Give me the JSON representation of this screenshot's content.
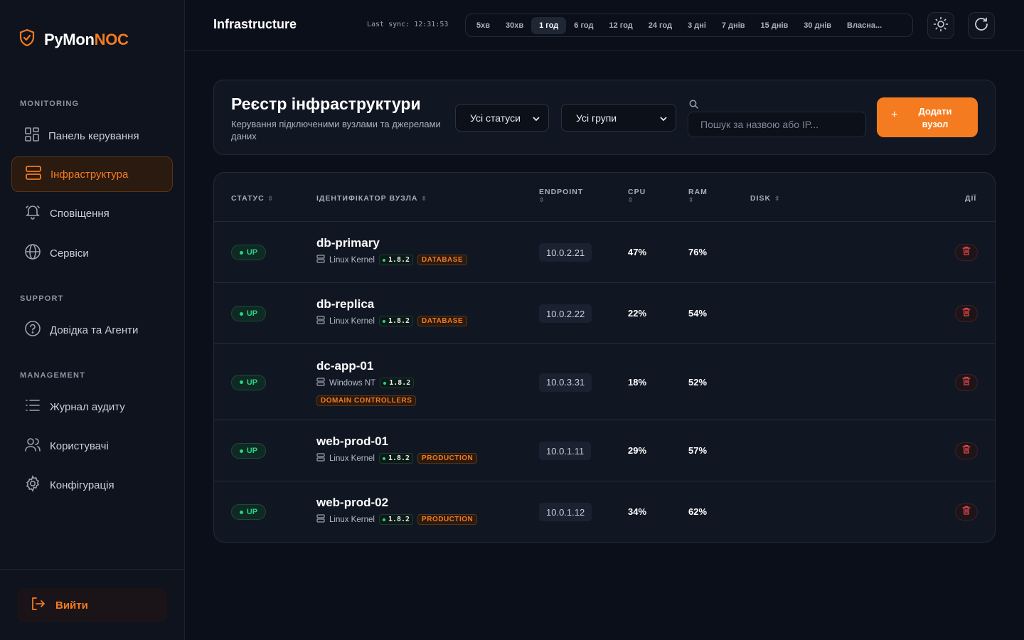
{
  "brand": {
    "name_main": "PyMon",
    "name_accent": "NOC",
    "accent_color": "#f47b20"
  },
  "sidebar": {
    "sections": [
      {
        "label": "MONITORING"
      },
      {
        "label": "SUPPORT"
      },
      {
        "label": "MANAGEMENT"
      }
    ],
    "items": [
      {
        "label": "Панель керування",
        "icon": "dashboard-icon"
      },
      {
        "label": "Інфраструктура",
        "icon": "server-icon",
        "active": true
      },
      {
        "label": "Сповіщення",
        "icon": "bell-icon"
      },
      {
        "label": "Сервіси",
        "icon": "globe-icon"
      },
      {
        "label": "Довідка та Агенти",
        "icon": "help-icon"
      },
      {
        "label": "Журнал аудиту",
        "icon": "list-icon"
      },
      {
        "label": "Користувачі",
        "icon": "users-icon"
      },
      {
        "label": "Конфігурація",
        "icon": "gear-icon"
      }
    ],
    "logout_label": "Вийти"
  },
  "header": {
    "title": "Infrastructure",
    "last_sync": "Last sync: 12:31:53",
    "ranges": [
      "5хв",
      "30хв",
      "1 год",
      "6 год",
      "12 год",
      "24 год",
      "3 дні",
      "7 днів",
      "15 днів",
      "30 днів",
      "Власна..."
    ],
    "active_range": "1 год"
  },
  "registry": {
    "title": "Реєстр інфраструктури",
    "subtitle": "Керування підключеними вузлами та джерелами даних",
    "status_filter": "Усі статуси",
    "group_filter": "Усі групи",
    "search_placeholder": "Пошук за назвою або IP...",
    "add_button": "Додати вузол"
  },
  "table": {
    "columns": {
      "status": "СТАТУС",
      "node": "ІДЕНТИФІКАТОР ВУЗЛА",
      "endpoint": "ENDPOINT",
      "cpu": "CPU",
      "ram": "RAM",
      "disk": "DISK",
      "actions": "ДІЇ"
    },
    "rows": [
      {
        "status": "UP",
        "name": "db-primary",
        "os": "Linux Kernel",
        "version": "1.8.2",
        "tag": "DATABASE",
        "ip": "10.0.2.21",
        "cpu": "47%",
        "ram": "76%"
      },
      {
        "status": "UP",
        "name": "db-replica",
        "os": "Linux Kernel",
        "version": "1.8.2",
        "tag": "DATABASE",
        "ip": "10.0.2.22",
        "cpu": "22%",
        "ram": "54%"
      },
      {
        "status": "UP",
        "name": "dc-app-01",
        "os": "Windows NT",
        "version": "1.8.2",
        "tag": "DOMAIN CONTROLLERS",
        "ip": "10.0.3.31",
        "cpu": "18%",
        "ram": "52%"
      },
      {
        "status": "UP",
        "name": "web-prod-01",
        "os": "Linux Kernel",
        "version": "1.8.2",
        "tag": "PRODUCTION",
        "ip": "10.0.1.11",
        "cpu": "29%",
        "ram": "57%"
      },
      {
        "status": "UP",
        "name": "web-prod-02",
        "os": "Linux Kernel",
        "version": "1.8.2",
        "tag": "PRODUCTION",
        "ip": "10.0.1.12",
        "cpu": "34%",
        "ram": "62%"
      }
    ]
  }
}
